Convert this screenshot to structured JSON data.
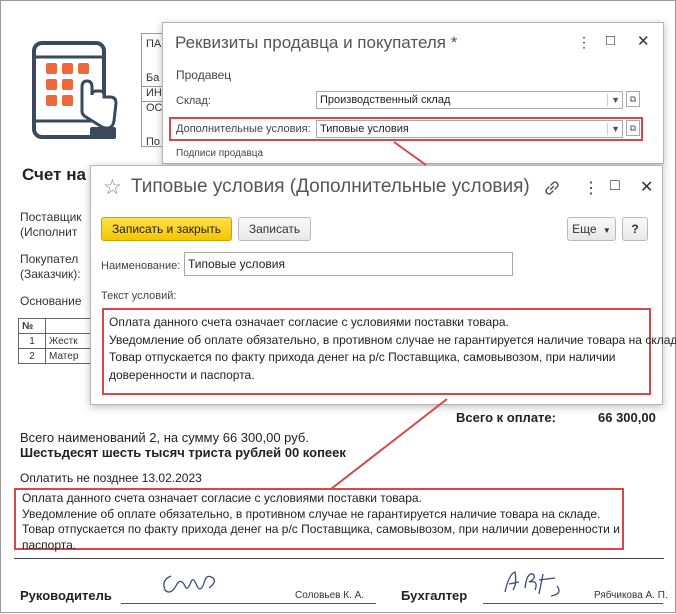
{
  "document": {
    "title": "Счет на",
    "header_fragments": [
      "ПА",
      "Ба",
      "ИН",
      "ОС",
      "По"
    ],
    "supplier_lines": [
      "Поставщик",
      "(Исполнит"
    ],
    "buyer_lines": [
      "Покупател",
      "(Заказчик):"
    ],
    "basis": "Основание",
    "items_header": [
      "№",
      ""
    ],
    "items": [
      {
        "num": "1",
        "name": "Жестк"
      },
      {
        "num": "2",
        "name": "Матер"
      }
    ],
    "total_label": "Всего к оплате:",
    "total_value": "66 300,00",
    "summary_line": "Всего наименований 2, на сумму 66 300,00 руб.",
    "summary_words": "Шестьдесят шесть тысяч триста рублей 00 копеек",
    "pay_before": "Оплатить не позднее 13.02.2023",
    "terms_lines": [
      "Оплата данного счета означает согласие с условиями поставки товара.",
      "Уведомление об оплате обязательно, в противном случае не гарантируется наличие товара на складе.",
      "Товар отпускается по факту прихода денег на р/с Поставщика, самовывозом, при наличии доверенности и",
      "паспорта."
    ],
    "signatures": {
      "director_label": "Руководитель",
      "director_name": "Соловьев К. А.",
      "accountant_label": "Бухгалтер",
      "accountant_name": "Рябчикова А. П."
    }
  },
  "seller_buyer_window": {
    "title": "Реквизиты продавца и покупателя *",
    "section_seller": "Продавец",
    "warehouse_label": "Склад:",
    "warehouse_value": "Производственный склад",
    "conditions_label": "Дополнительные условия:",
    "conditions_value": "Типовые условия",
    "seller_signatures_link": "Подписи продавца"
  },
  "terms_window": {
    "title": "Типовые условия (Дополнительные условия)",
    "save_close_label": "Записать и закрыть",
    "save_label": "Записать",
    "more_label": "Еще",
    "help_label": "?",
    "name_label": "Наименование:",
    "name_value": "Типовые условия",
    "text_label": "Текст условий:",
    "text_lines": [
      "Оплата данного счета означает согласие с условиями поставки товара.",
      "Уведомление об оплате обязательно, в противном случае не гарантируется наличие товара на складе.",
      "Товар отпускается по факту прихода денег на р/с Поставщика, самовывозом, при наличии",
      "доверенности и паспорта."
    ]
  },
  "colors": {
    "highlight": "#d9474b",
    "logo_orange": "#ef6a3a",
    "logo_dark": "#3a4a5c",
    "link_green": "#2e8b3a",
    "button_yellow": "#f3c600"
  },
  "icons": {
    "logo": "tablet-tap-icon",
    "menu": "more-vertical-icon",
    "maximize": "maximize-icon",
    "close": "close-icon",
    "favorite": "star-icon",
    "link": "link-icon"
  }
}
